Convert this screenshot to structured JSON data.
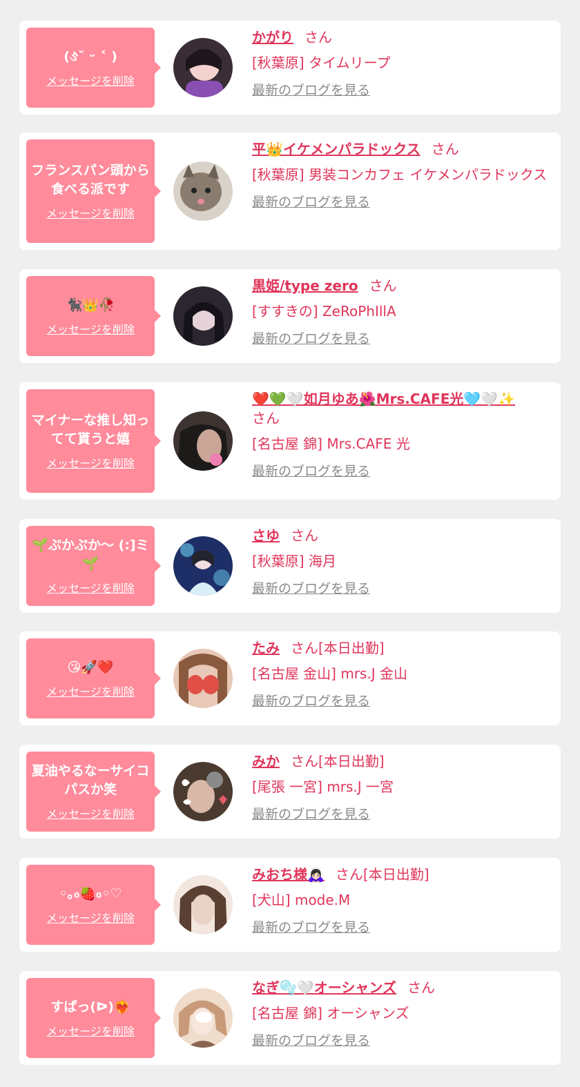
{
  "items": [
    {
      "message": "(ઙ̀ˇ ᵕ ˂ )",
      "delete_label": "メッセージを削除",
      "name": "かがり",
      "san": "さん",
      "shop": "[秋葉原] タイムリープ",
      "blog_label": "最新のブログを見る",
      "avatar_colors": [
        "#f4c8c9",
        "#2a1f2a",
        "#8a4fb2"
      ]
    },
    {
      "message": "フランスパン頭から食べる派です",
      "delete_label": "メッセージを削除",
      "name": "平👑イケメンパラドックス",
      "san": "さん",
      "shop": "[秋葉原] 男装コンカフェ イケメンパラドックス",
      "blog_label": "最新のブログを見る",
      "avatar_colors": [
        "#b9ada0",
        "#5d5349",
        "#e8e2d8"
      ]
    },
    {
      "message": "🐈‍⬛👑🥀",
      "delete_label": "メッセージを削除",
      "name": "黒姫/type zero",
      "san": "さん",
      "shop": "[すすきの] ZeRoPhIllA",
      "blog_label": "最新のブログを見る",
      "avatar_colors": [
        "#2c2630",
        "#cdb9c3",
        "#4b3e48"
      ]
    },
    {
      "message": "マイナーな推し知ってて貰うと嬉",
      "delete_label": "メッセージを削除",
      "name": "❤️💚🤍如月ゆあ🌺Mrs.CAFE光🩵🤍✨",
      "san": "さん",
      "shop": "[名古屋 錦] Mrs.CAFE 光",
      "blog_label": "最新のブログを見る",
      "avatar_colors": [
        "#1d1a1a",
        "#5a4a46",
        "#f07fb1"
      ]
    },
    {
      "message": "🌱ぷかぷか〜 (:]ミ🌱",
      "delete_label": "メッセージを削除",
      "name": "さゆ",
      "san": "さん",
      "shop": "[秋葉原] 海月",
      "blog_label": "最新のブログを見る",
      "avatar_colors": [
        "#1e2e66",
        "#6ad0f0",
        "#d9eef8"
      ]
    },
    {
      "message": "😘🚀❤️",
      "delete_label": "メッセージを削除",
      "name": "たみ",
      "san": "さん[本日出勤]",
      "shop": "[名古屋 金山] mrs.J 金山",
      "blog_label": "最新のブログを見る",
      "avatar_colors": [
        "#e8c8b6",
        "#8a5a3e",
        "#e05046"
      ]
    },
    {
      "message": "夏油やるなーサイコパスか笑",
      "delete_label": "メッセージを削除",
      "name": "みか",
      "san": "さん[本日出勤]",
      "shop": "[尾張 一宮] mrs.J 一宮",
      "blog_label": "最新のブログを見る",
      "avatar_colors": [
        "#4a3a30",
        "#d8b8a6",
        "#ffffff"
      ]
    },
    {
      "message": "◦｡₀🍓₀◦♡",
      "delete_label": "メッセージを削除",
      "name": "みおち様🙇🏻‍♀️",
      "san": "さん[本日出勤]",
      "shop": "[犬山] mode.M",
      "blog_label": "最新のブログを見る",
      "avatar_colors": [
        "#d6c6bc",
        "#5a4032",
        "#f2e6de"
      ]
    },
    {
      "message": "すぱっ(ᐅ)❤️‍🔥",
      "delete_label": "メッセージを削除",
      "name": "なぎ🫧🤍オーシャンズ",
      "san": "さん",
      "shop": "[名古屋 錦] オーシャンズ",
      "blog_label": "最新のブログを見る",
      "avatar_colors": [
        "#c89a7a",
        "#f0dccb",
        "#8a6450"
      ]
    }
  ]
}
